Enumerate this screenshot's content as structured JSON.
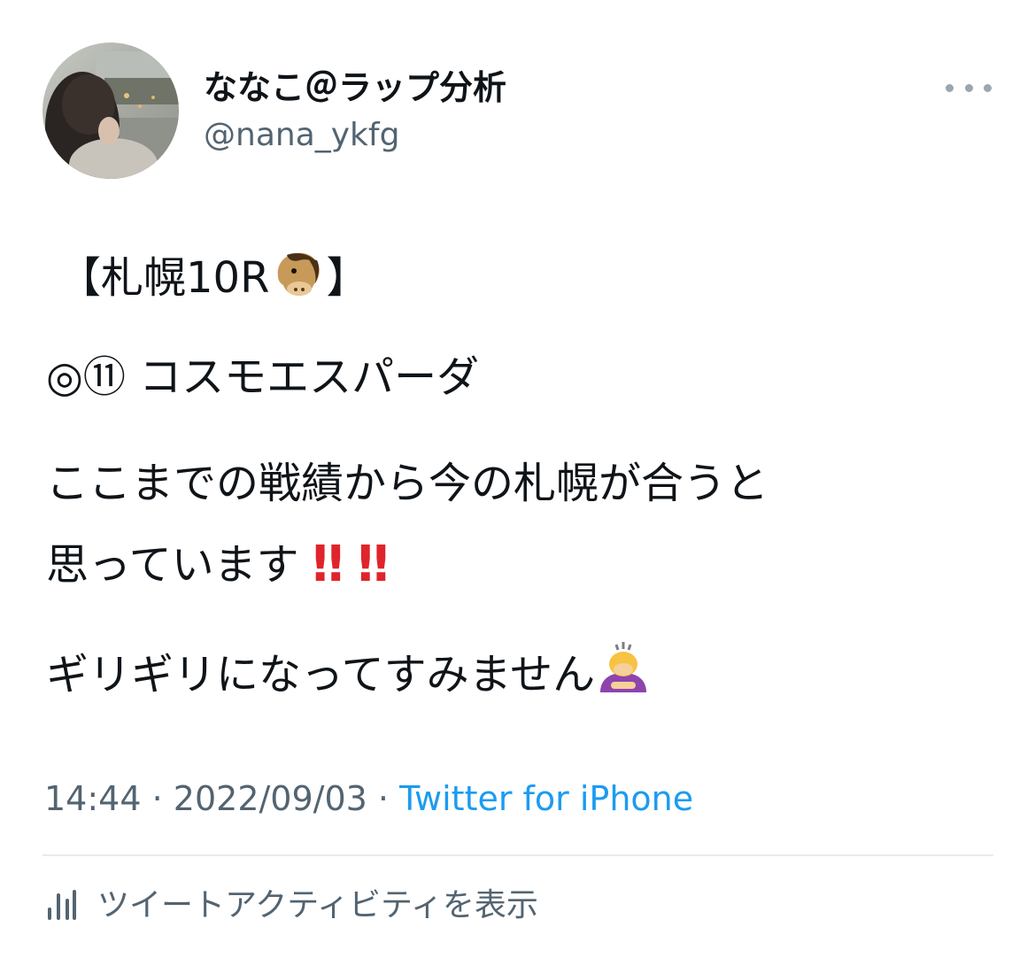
{
  "user": {
    "display_name": "ななこ＠ラップ分析",
    "handle": "@nana_ykfg",
    "avatar_icon": "profile-photo"
  },
  "menu": {
    "icon": "more-dots-icon"
  },
  "tweet": {
    "line1": "【札幌10R",
    "line1_end": "】",
    "line2": "◎⑪ コスモエスパーダ",
    "line3": "ここまでの戦績から今の札幌が合うと",
    "line4": "思っています",
    "line4_emphasis": [
      "‼",
      "‼"
    ],
    "line5": "ギリギリになってすみません",
    "emojis": [
      "horse-face-emoji",
      "double-exclamation-emoji",
      "person-bowing-emoji"
    ]
  },
  "meta": {
    "time": "14:44",
    "separator": "·",
    "date": "2022/09/03",
    "source": "Twitter for iPhone"
  },
  "activity": {
    "label": "ツイートアクティビティを表示",
    "icon": "analytics-bars-icon"
  },
  "colors": {
    "text": "#0f1419",
    "secondary": "#536471",
    "link": "#1d9bf0",
    "emphasis": "#e0242b",
    "divider": "#e7ebee"
  }
}
